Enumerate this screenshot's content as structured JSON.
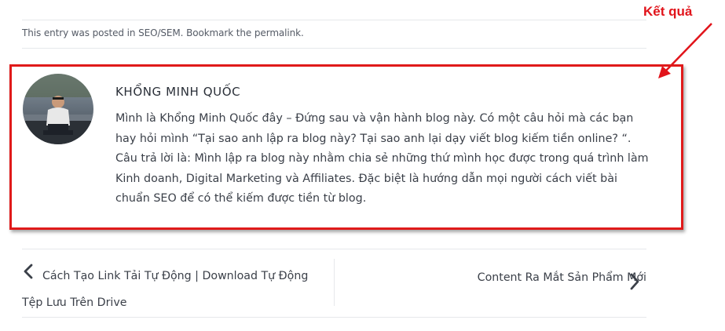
{
  "annotation": {
    "label": "Kết quả",
    "color": "#e1141b"
  },
  "entry_meta": {
    "prefix": "This entry was posted in",
    "category": "SEO/SEM",
    "middle": ". Bookmark the",
    "permalink": "permalink",
    "suffix": "."
  },
  "author": {
    "name": "KHỔNG MINH QUỐC",
    "bio": "Mình là Khổng Minh Quốc đây – Đứng sau và vận hành blog này. Có một câu hỏi mà các bạn hay hỏi mình “Tại sao anh lập ra blog này? Tại sao anh lại dạy viết blog kiếm tiền online? “. Câu trả lời là: Mình lập ra blog này nhằm chia sẻ những thứ mình học được trong quá trình làm Kinh doanh, Digital Marketing và Affiliates. Đặc biệt là hướng dẫn mọi người cách viết bài chuẩn SEO để có thể kiếm được tiền từ blog.",
    "avatar_icon": "author-avatar"
  },
  "post_nav": {
    "prev_label": "Cách Tạo Link Tải Tự Động | Download Tự Động Tệp Lưu Trên Drive",
    "next_label": "Content Ra Mắt Sản Phẩm Mới",
    "prev_icon": "chevron-left-icon",
    "next_icon": "chevron-right-icon"
  }
}
